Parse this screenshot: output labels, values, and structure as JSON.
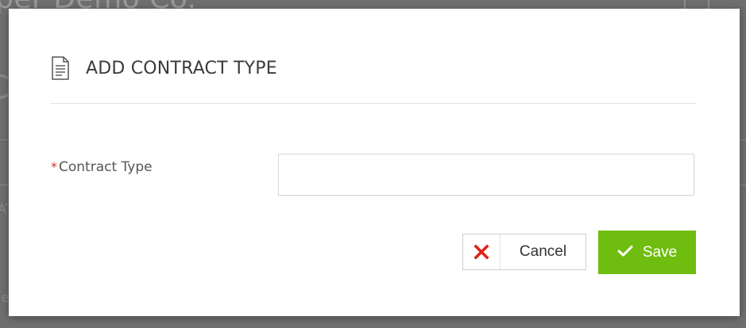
{
  "background": {
    "page_title": "per Demo Co.",
    "fragment_o": "C",
    "fragment_at": "AT",
    "fragment_le": "le"
  },
  "modal": {
    "title": "ADD CONTRACT TYPE",
    "icon": "document-icon"
  },
  "form": {
    "required_mark": "*",
    "contract_type_label": "Contract Type",
    "contract_type_value": "",
    "contract_type_placeholder": ""
  },
  "buttons": {
    "cancel_label": "Cancel",
    "cancel_icon": "close-icon",
    "save_label": "Save",
    "save_icon": "checkmark-icon"
  },
  "colors": {
    "save_button": "#6fbd0e",
    "cancel_icon": "#e0231a",
    "required_mark": "#d9342b",
    "overlay": "#6f6f6f"
  }
}
